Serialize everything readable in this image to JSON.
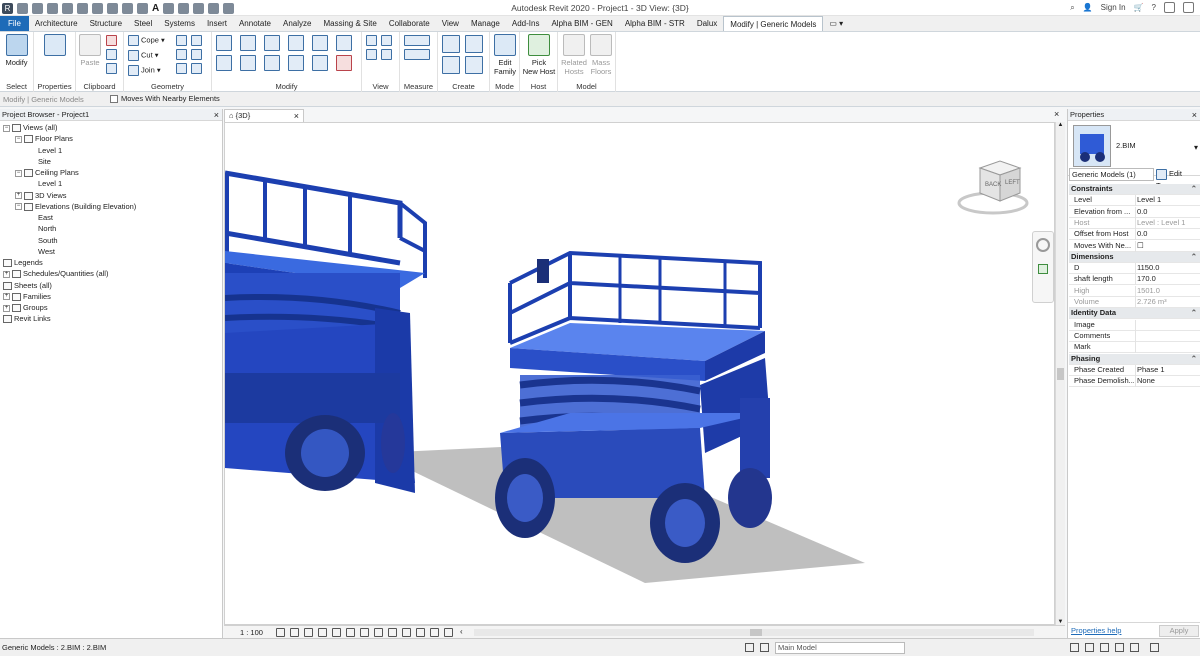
{
  "app": {
    "title": "Autodesk Revit 2020 - Project1 - 3D View: {3D}",
    "user": "Sign In",
    "qat_letter": "A"
  },
  "tabs": [
    "File",
    "Architecture",
    "Structure",
    "Steel",
    "Systems",
    "Insert",
    "Annotate",
    "Analyze",
    "Massing & Site",
    "Collaborate",
    "View",
    "Manage",
    "Add-Ins",
    "Alpha BIM - GEN",
    "Alpha BIM - STR",
    "Dalux",
    "Modify | Generic Models"
  ],
  "ribbon": {
    "select": {
      "button": "Modify",
      "label": "Select"
    },
    "properties": {
      "button": "Properties",
      "label": "Properties"
    },
    "clipboard": {
      "paste": "Paste",
      "label": "Clipboard"
    },
    "geometry": {
      "cope": "Cope",
      "cut": "Cut",
      "join": "Join",
      "label": "Geometry"
    },
    "modify": {
      "label": "Modify"
    },
    "view": {
      "label": "View"
    },
    "measure": {
      "label": "Measure"
    },
    "create": {
      "label": "Create"
    },
    "mode": {
      "button_line1": "Edit",
      "button_line2": "Family",
      "label": "Mode"
    },
    "host": {
      "button_line1": "Pick",
      "button_line2": "New Host",
      "label": "Host"
    },
    "model": {
      "related_line1": "Related",
      "related_line2": "Hosts",
      "mass_line1": "Mass",
      "mass_line2": "Floors",
      "label": "Model"
    }
  },
  "optionsbar": {
    "context": "Modify | Generic Models",
    "checkbox": "Moves With Nearby Elements"
  },
  "browser": {
    "title": "Project Browser - Project1",
    "tree": [
      {
        "label": "Views (all)",
        "level": 0,
        "exp": "−"
      },
      {
        "label": "Floor Plans",
        "level": 1,
        "exp": "−"
      },
      {
        "label": "Level 1",
        "level": 2,
        "exp": ""
      },
      {
        "label": "Site",
        "level": 2,
        "exp": ""
      },
      {
        "label": "Ceiling Plans",
        "level": 1,
        "exp": "−"
      },
      {
        "label": "Level 1",
        "level": 2,
        "exp": ""
      },
      {
        "label": "3D Views",
        "level": 1,
        "exp": "+"
      },
      {
        "label": "Elevations (Building Elevation)",
        "level": 1,
        "exp": "−"
      },
      {
        "label": "East",
        "level": 2,
        "exp": ""
      },
      {
        "label": "North",
        "level": 2,
        "exp": ""
      },
      {
        "label": "South",
        "level": 2,
        "exp": ""
      },
      {
        "label": "West",
        "level": 2,
        "exp": ""
      },
      {
        "label": "Legends",
        "level": 0,
        "exp": ""
      },
      {
        "label": "Schedules/Quantities (all)",
        "level": 0,
        "exp": "+"
      },
      {
        "label": "Sheets (all)",
        "level": 0,
        "exp": ""
      },
      {
        "label": "Families",
        "level": 0,
        "exp": "+"
      },
      {
        "label": "Groups",
        "level": 0,
        "exp": "+"
      },
      {
        "label": "Revit Links",
        "level": 0,
        "exp": ""
      }
    ]
  },
  "view": {
    "tab": "{3D}",
    "scale": "1 : 100",
    "viewcube_left": "BACK",
    "viewcube_right": "LEFT"
  },
  "properties": {
    "title": "Properties",
    "type_name": "2.BIM",
    "selector": "Generic Models (1)",
    "edit_type": "Edit Type",
    "help": "Properties help",
    "apply": "Apply",
    "rows": [
      {
        "k": "Constraints",
        "v": "⌃",
        "kind": "sec"
      },
      {
        "k": "Level",
        "v": "Level 1",
        "kind": ""
      },
      {
        "k": "Elevation from ...",
        "v": "0.0",
        "kind": ""
      },
      {
        "k": "Host",
        "v": "Level : Level 1",
        "kind": "grey"
      },
      {
        "k": "Offset from Host",
        "v": "0.0",
        "kind": ""
      },
      {
        "k": "Moves With Ne...",
        "v": "☐",
        "kind": ""
      },
      {
        "k": "Dimensions",
        "v": "⌃",
        "kind": "sec"
      },
      {
        "k": "D",
        "v": "1150.0",
        "kind": ""
      },
      {
        "k": "shaft length",
        "v": "170.0",
        "kind": ""
      },
      {
        "k": "High",
        "v": "1501.0",
        "kind": "grey"
      },
      {
        "k": "Volume",
        "v": "2.726 m³",
        "kind": "grey"
      },
      {
        "k": "Identity Data",
        "v": "⌃",
        "kind": "sec"
      },
      {
        "k": "Image",
        "v": "",
        "kind": ""
      },
      {
        "k": "Comments",
        "v": "",
        "kind": ""
      },
      {
        "k": "Mark",
        "v": "",
        "kind": ""
      },
      {
        "k": "Phasing",
        "v": "⌃",
        "kind": "sec"
      },
      {
        "k": "Phase Created",
        "v": "Phase 1",
        "kind": ""
      },
      {
        "k": "Phase Demolish...",
        "v": "None",
        "kind": ""
      }
    ]
  },
  "status": {
    "message": "Generic Models : 2.BIM : 2.BIM",
    "workset": "Main Model"
  },
  "colors": {
    "model_blue": "#2f5bd6",
    "accent": "#1e6bb8"
  }
}
